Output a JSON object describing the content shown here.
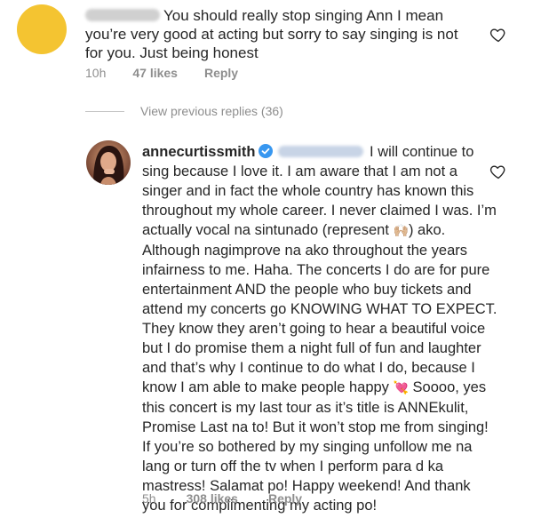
{
  "comment1": {
    "text": "You should really stop singing Ann I mean you’re very good at acting but sorry to say singing is not for you. Just being honest",
    "time": "10h",
    "likes": "47 likes",
    "reply": "Reply"
  },
  "view_replies": "View previous replies (36)",
  "comment2": {
    "username": "annecurtissmith",
    "text_part1": " I will continue to sing because I love it. I am aware that I am not a singer and in fact the whole country has known this throughout my whole career. I never claimed I was. I’m actually vocal na sintunado (represent ",
    "emoji1": "🙌🏼",
    "text_part2": ") ako. Although nagimprove na ako throughout the years infairness to me. Haha. The concerts I do are for pure entertainment AND the people who buy tickets and attend my concerts go KNOWING WHAT TO EXPECT. They know they aren’t going to hear a beautiful voice but I do promise them a night full of fun and laughter and that’s why I continue to do what I do, because I know I am able to make people happy ",
    "emoji2": "💘",
    "text_part3": " Soooo, yes this concert is my last tour as it’s title is ANNEkulit, Promise Last na to! But it won’t stop me from singing! If you’re so bothered by my singing unfollow me na lang or turn off the tv when I perform para d ka mastress! Salamat po! Happy weekend! And thank you for complimenting my acting po!",
    "time": "5h",
    "likes": "308 likes",
    "reply": "Reply"
  },
  "colors": {
    "avatar_yellow": "#f4c431",
    "meta_gray": "#8e8e8e",
    "verified_blue": "#3897f0"
  }
}
